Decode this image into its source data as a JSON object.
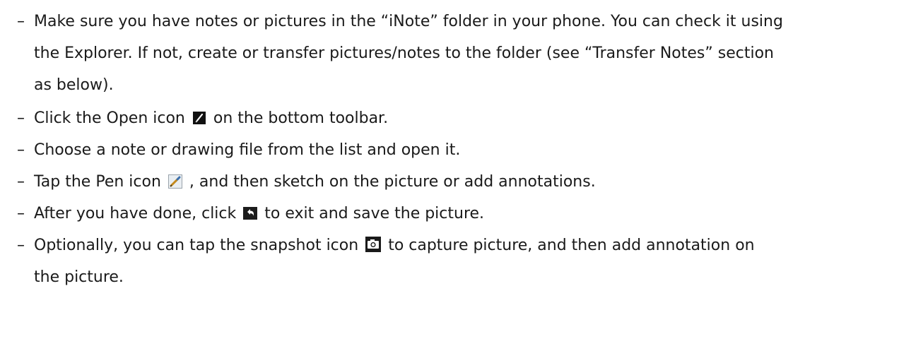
{
  "bullets": [
    {
      "lines": [
        "Make sure you have notes or pictures in the “iNote” folder in your phone. You can check it using",
        "the Explorer. If not, create or transfer pictures/notes to the folder (see “Transfer Notes” section",
        "as below)."
      ]
    },
    {
      "before": "Click the Open icon",
      "after": "on the bottom toolbar.",
      "icon": "open-icon"
    },
    {
      "text": "Choose a note or drawing file from the list and open it."
    },
    {
      "before": "Tap the Pen icon",
      "after": ", and then sketch on the picture or add annotations.",
      "icon": "pen-icon"
    },
    {
      "before": "After you have done, click",
      "after": "to exit and save the picture.",
      "icon": "back-icon"
    },
    {
      "before": "Optionally, you can tap the snapshot icon",
      "after": "to capture picture, and then add annotation on",
      "line2": "the picture.",
      "icon": "camera-icon"
    }
  ],
  "bullet_marker": "–"
}
